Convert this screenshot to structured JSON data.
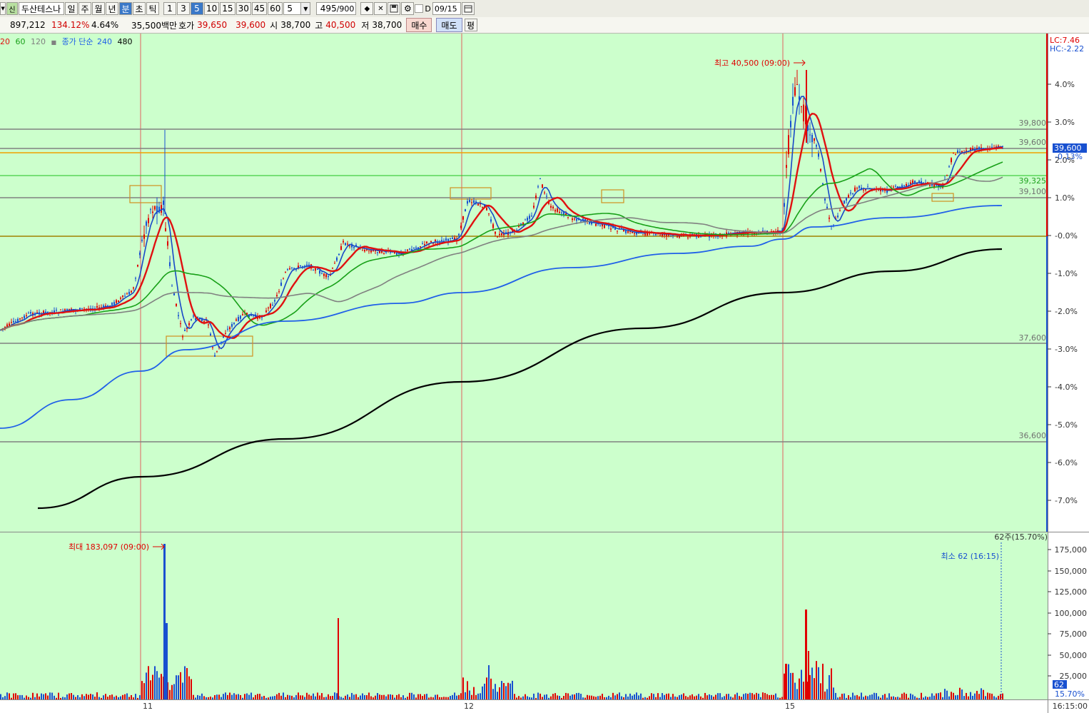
{
  "toolbar": {
    "stock_badge": "신",
    "stock_name": "두산테스나",
    "periods": [
      "일",
      "주",
      "월",
      "년",
      "분",
      "초",
      "틱"
    ],
    "active_period": "분",
    "intervals": [
      "1",
      "3",
      "5",
      "10",
      "15",
      "30",
      "45",
      "60"
    ],
    "active_interval": "5",
    "interval_select": "5",
    "count": "495",
    "count_total": "/900",
    "date_checkbox_label": "D",
    "date": "09/15"
  },
  "info": {
    "volume": "897,212",
    "volume_ratio": "134.12%",
    "turnover": "4.64%",
    "amount": "35,500백만",
    "bid_label": "호가",
    "ask": "39,650",
    "bid": "39,600",
    "open_label": "시",
    "open": "38,700",
    "high_label": "고",
    "high": "40,500",
    "low_label": "저",
    "low": "38,700",
    "buy_label": "매수",
    "sell_label": "매도",
    "flat_label": "평"
  },
  "legend": {
    "ma20": "20",
    "ma60": "60",
    "ma120": "120",
    "price_type": "종가 단순",
    "ma240": "240",
    "ma480": "480"
  },
  "colors": {
    "background": "#ccffcc",
    "up": "#e00000",
    "down": "#1850d0",
    "ma5": "#1848c8",
    "ma10": "#e01010",
    "ma20": "#18a018",
    "ma60": "#808080",
    "ma120": "#2060e8",
    "ma480": "#000000"
  },
  "axis": {
    "lc": "LC:7.46",
    "hc": "HC:-2.22",
    "pct_ticks": [
      "4.0%",
      "3.0%",
      "2.0%",
      "1.0%",
      "-0.0%",
      "-1.0%",
      "-2.0%",
      "-3.0%",
      "-4.0%",
      "-5.0%",
      "-6.0%",
      "-7.0%"
    ],
    "current_price": "39,600",
    "current_change": "-0.13%",
    "vol_ticks": [
      "175,000",
      "150,000",
      "125,000",
      "100,000",
      "75,000",
      "50,000",
      "25,000"
    ],
    "vol_bottom_pct": "15.70%",
    "vol_current": "62",
    "time_end": "16:15:00",
    "dates": [
      "11",
      "12",
      "15"
    ]
  },
  "levels": [
    "39,800",
    "39,600",
    "39,325",
    "39,100",
    "37,600",
    "36,600"
  ],
  "annotations": {
    "price_high": "최고 40,500 (09:00)",
    "vol_max": "최대 183,097 (09:00)",
    "vol_min": "최소 62 (16:15)",
    "vol_count": "62주(15.70%)"
  }
}
